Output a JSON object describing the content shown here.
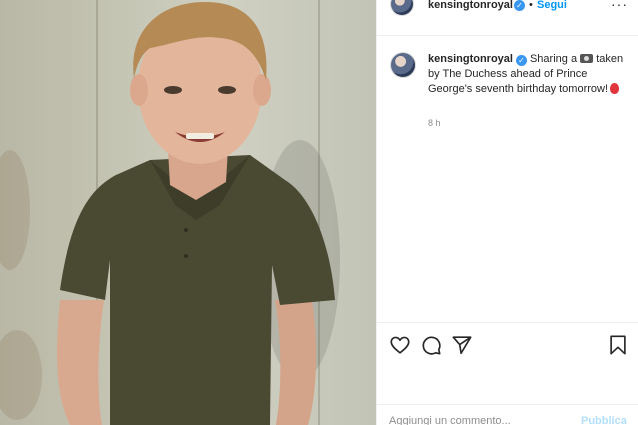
{
  "post": {
    "username": "kensingtonroyal",
    "verified_mark": "✓",
    "separator": "•",
    "follow_label": "Segui",
    "more_label": "···",
    "caption_text_1": "Sharing a",
    "caption_text_2": "taken by The Duchess ahead of Prince George's seventh birthday tomorrow!",
    "time_ago": "8 h",
    "photo_description": "boy-in-green-polo-photo"
  },
  "actions": {
    "like_icon": "heart-icon",
    "comment_icon": "comment-bubble-icon",
    "share_icon": "paper-plane-icon",
    "save_icon": "bookmark-icon"
  },
  "comment_box": {
    "placeholder": "Aggiungi un commento...",
    "publish_label": "Pubblica"
  },
  "colors": {
    "link_blue": "#0095f6",
    "verified_blue": "#3897f0",
    "publish_disabled": "#b2dffc",
    "muted_text": "#8e8e8e"
  }
}
